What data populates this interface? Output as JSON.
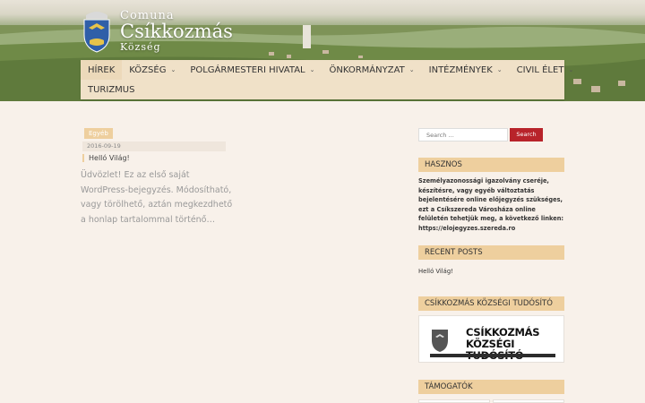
{
  "logo": {
    "line1": "Comuna",
    "line2": "Csíkkozmás",
    "line3": "Község"
  },
  "nav": {
    "items": [
      {
        "label": "HÍREK",
        "caret": false
      },
      {
        "label": "KÖZSÉG",
        "caret": true
      },
      {
        "label": "POLGÁRMESTERI HIVATAL",
        "caret": true
      },
      {
        "label": "ÖNKORMÁNYZAT",
        "caret": true
      },
      {
        "label": "INTÉZMÉNYEK",
        "caret": true
      },
      {
        "label": "CIVIL ÉLET",
        "caret": true
      }
    ],
    "row2": {
      "label": "TURIZMUS"
    }
  },
  "post": {
    "category": "Egyéb",
    "date": "2016-09-19",
    "title": "Helló Világ!",
    "excerpt": "Üdvözlet! Ez az első saját WordPress-bejegyzés. Módosítható, vagy törölhető, aztán megkezdhető a honlap tartalommal történő…"
  },
  "search": {
    "placeholder": "Search …",
    "button": "Search"
  },
  "widgets": {
    "hasznos": {
      "title": "HASZNOS",
      "text": "Személyazonossági igazolvány cseréje, készítésre, vagy egyéb változtatás bejelentésére online előjegyzés szükséges, ezt a Csíkszereda Városháza online felületén tehetjük meg, a következő linken: https://elojegyzes.szereda.ro"
    },
    "recent": {
      "title": "RECENT POSTS",
      "item": "Helló Világ!"
    },
    "tudosito": {
      "title": "CSÍKKOZMÁS KÖZSÉGI TUDÓSÍTÓ",
      "image_line1": "CSÍKKOZMÁS",
      "image_line2": "KÖZSÉGI TUDÓSÍTÓ"
    },
    "tamogatok": {
      "title": "TÁMOGATÓK"
    }
  },
  "colors": {
    "accent": "#eecf9e",
    "search_button": "#b8232a",
    "nav_bg": "#f0e1c8",
    "page_bg": "#f8f1ea"
  }
}
